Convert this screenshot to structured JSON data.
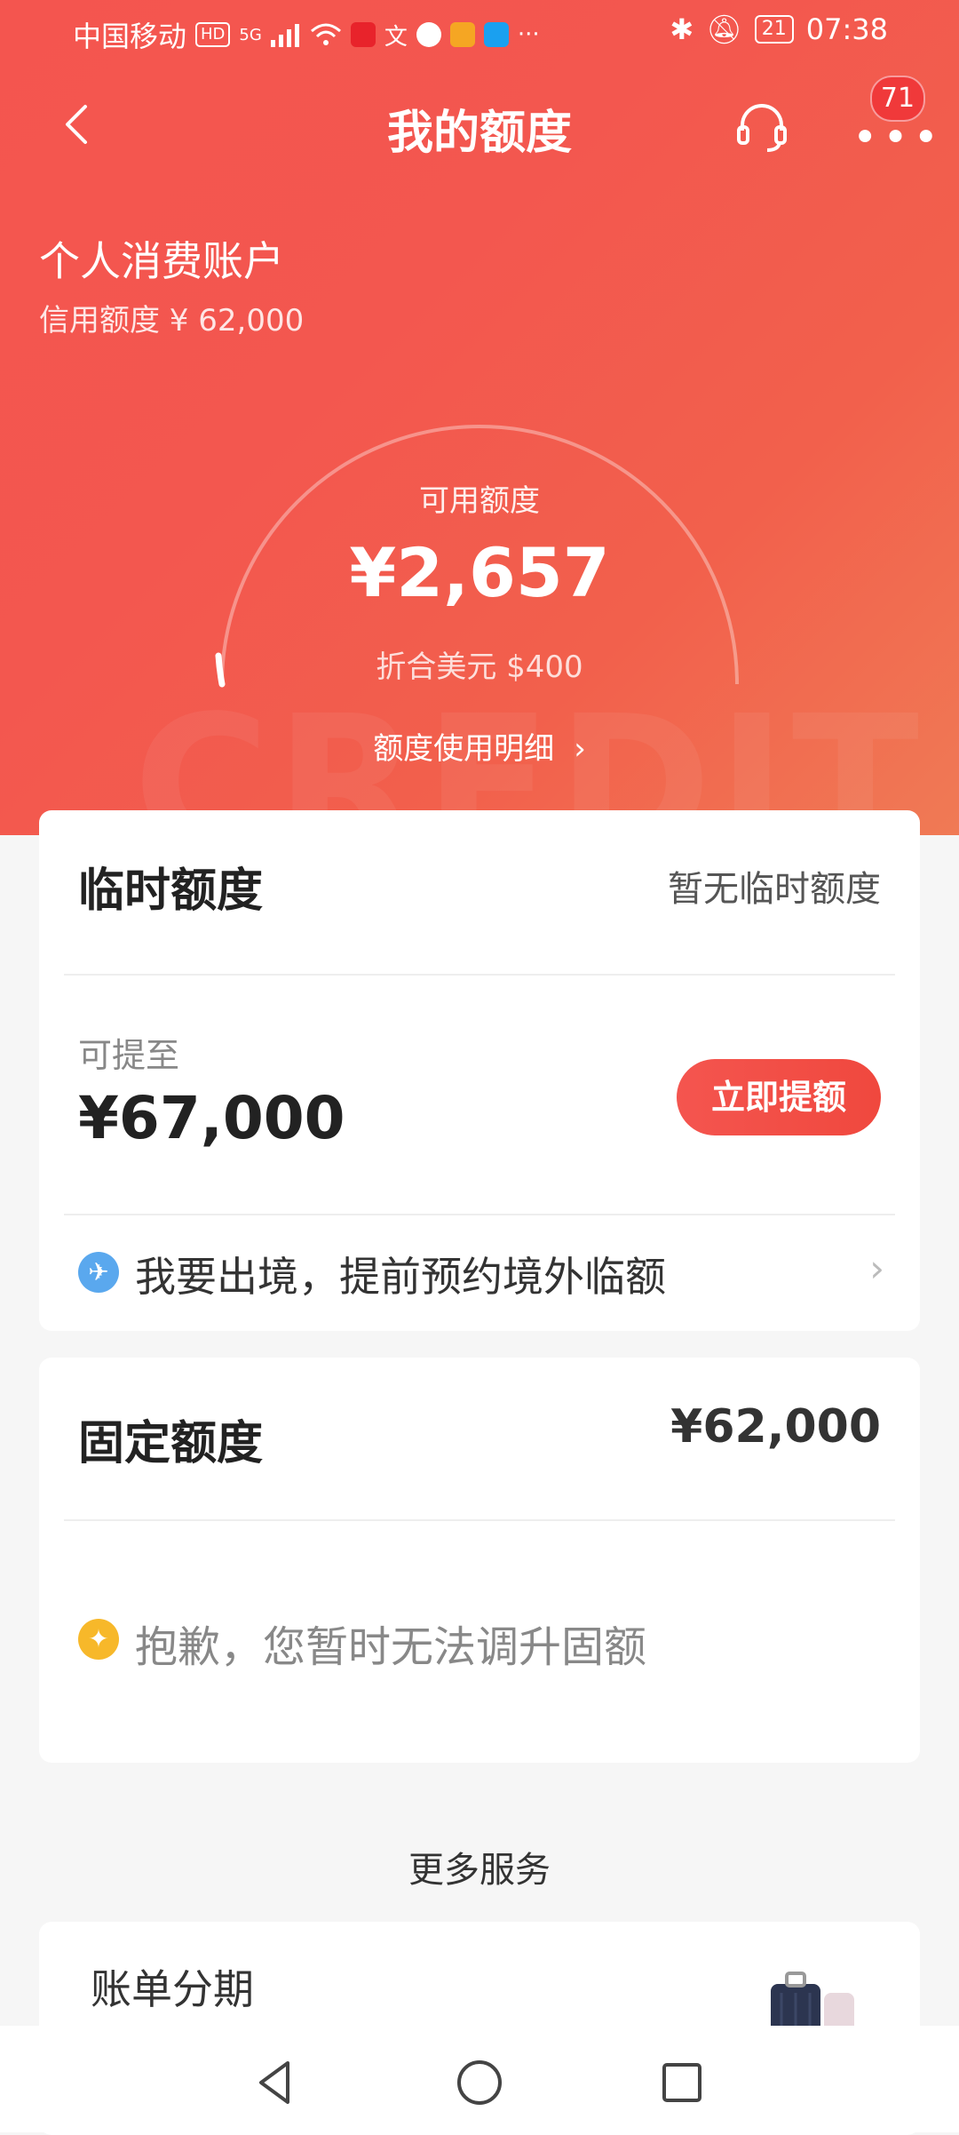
{
  "status_bar": {
    "carrier": "中国移动",
    "hd": "HD",
    "network": "5G",
    "dots": "···",
    "battery": "21",
    "time": "07:38"
  },
  "header": {
    "title": "我的额度",
    "badge_count": "71"
  },
  "account": {
    "title": "个人消费账户",
    "credit_line": "信用额度 ¥ 62,000"
  },
  "available": {
    "label": "可用额度",
    "amount": "¥2,657",
    "usd": "折合美元 $400",
    "detail_link": "额度使用明细",
    "ratio": 0.043
  },
  "temp_limit": {
    "title": "临时额度",
    "status": "暂无临时额度",
    "up_to_label": "可提至",
    "up_to_amount": "¥67,000",
    "raise_button": "立即提额",
    "travel_row": "我要出境，提前预约境外临额"
  },
  "fixed_limit": {
    "title": "固定额度",
    "amount": "¥62,000",
    "notice": "抱歉，您暂时无法调升固额"
  },
  "more_services": {
    "title": "更多服务",
    "items": [
      {
        "name": "账单分期"
      }
    ]
  },
  "colors": {
    "brand_red": "#f4554f",
    "plane_blue": "#5aa8ee",
    "bulb_yellow": "#f7b82a"
  },
  "icons": {
    "back": "back-icon",
    "support": "headset-icon",
    "more": "more-icon",
    "plane": "plane-icon",
    "bulb": "bulb-icon",
    "nav_back": "triangle-back-icon",
    "nav_home": "circle-home-icon",
    "nav_recents": "square-recents-icon"
  }
}
